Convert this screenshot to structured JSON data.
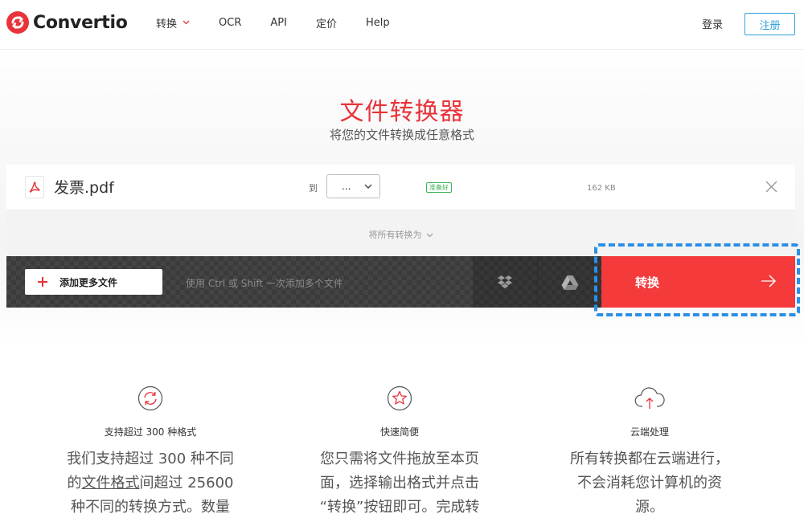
{
  "header": {
    "logo_text": "Convertio",
    "nav": [
      {
        "label": "转换",
        "has_dropdown": true
      },
      {
        "label": "OCR"
      },
      {
        "label": "API"
      },
      {
        "label": "定价"
      },
      {
        "label": "Help"
      }
    ],
    "login_label": "登录",
    "signup_label": "注册"
  },
  "hero": {
    "title": "文件转换器",
    "subtitle": "将您的文件转换成任意格式"
  },
  "file": {
    "name": "发票.pdf",
    "to_label": "到",
    "format_value": "...",
    "status": "准备好",
    "size": "162 KB"
  },
  "convert_all_label": "将所有转换为",
  "actions": {
    "add_more_label": "添加更多文件",
    "hint": "使用 Ctrl 或 Shift 一次添加多个文件",
    "convert_label": "转换"
  },
  "features": [
    {
      "icon": "refresh-icon",
      "title": "支持超过 300 种格式",
      "desc_line1": "我们支持超过 300 种不同",
      "desc_line2_pre": "的",
      "desc_line2_link": "文件格式",
      "desc_line2_post": "间超过 25600",
      "desc_line3": "种不同的转换方式。数量"
    },
    {
      "icon": "star-icon",
      "title": "快速简便",
      "desc_line1": "您只需将文件拖放至本页",
      "desc_line2": "面，选择输出格式并点击",
      "desc_line3": "“转换”按钮即可。完成转"
    },
    {
      "icon": "cloud-upload-icon",
      "title": "云端处理",
      "desc_line1": "所有转换都在云端进行，",
      "desc_line2": "不会消耗您计算机的资",
      "desc_line3": "源。"
    }
  ],
  "colors": {
    "brand_red": "#e8333a",
    "convert_red": "#f43a3a",
    "accent_blue": "#2fa0d8",
    "focus_blue": "#2b8fe6",
    "ready_green": "#3cb357"
  }
}
